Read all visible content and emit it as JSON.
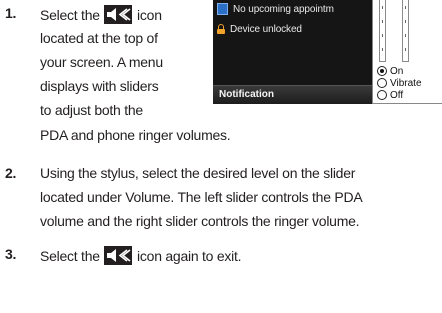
{
  "steps": [
    {
      "number": "1.",
      "lines": [
        {
          "before": "Select the ",
          "icon": true,
          "after": " icon"
        },
        {
          "text": "located at the top of"
        },
        {
          "text": "your screen. A menu"
        },
        {
          "text": "displays with sliders"
        },
        {
          "text": "to adjust both the"
        },
        {
          "text": "PDA and phone ringer volumes."
        }
      ]
    },
    {
      "number": "2.",
      "lines": [
        {
          "text": "Using the stylus, select the desired level on the slider"
        },
        {
          "text": "located under Volume. The left slider controls the PDA"
        },
        {
          "text": "volume and the right slider controls the ringer volume."
        }
      ]
    },
    {
      "number": "3.",
      "lines": [
        {
          "before": "Select the ",
          "icon": true,
          "after": " icon again to exit."
        }
      ]
    }
  ],
  "screenshot": {
    "notifications": [
      {
        "icon": "calendar-icon",
        "text": "No upcoming appointm"
      },
      {
        "icon": "unlocked-padlock-icon",
        "text": "Device unlocked"
      }
    ],
    "bar_label": "Notification",
    "ringer_options": [
      {
        "label": "On",
        "selected": true
      },
      {
        "label": "Vibrate",
        "selected": false
      },
      {
        "label": "Off",
        "selected": false
      }
    ]
  },
  "icon_name": "speaker-volume-icon",
  "colors": {
    "text": "#231f20",
    "icon": "#231f20",
    "screen_bg": "#151515"
  }
}
